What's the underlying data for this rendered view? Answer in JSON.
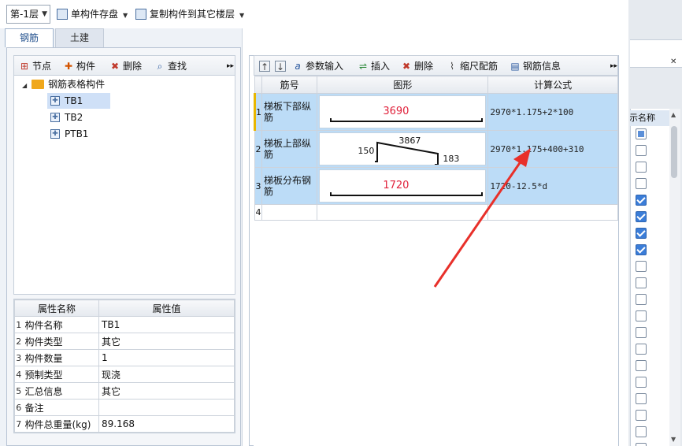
{
  "toolbar": {
    "floor": "第-1层",
    "single_save": "单构件存盘",
    "copy_to_floor": "复制构件到其它楼层"
  },
  "tabs": [
    "钢筋",
    "土建"
  ],
  "tree_toolbar": {
    "node": "节点",
    "component": "构件",
    "delete": "删除",
    "find": "查找"
  },
  "tree": {
    "root": "钢筋表格构件",
    "items": [
      "TB1",
      "TB2",
      "PTB1"
    ]
  },
  "props": {
    "header_name": "属性名称",
    "header_value": "属性值",
    "rows": [
      {
        "n": "1",
        "name": "构件名称",
        "value": "TB1"
      },
      {
        "n": "2",
        "name": "构件类型",
        "value": "其它"
      },
      {
        "n": "3",
        "name": "构件数量",
        "value": "1"
      },
      {
        "n": "4",
        "name": "预制类型",
        "value": "现浇"
      },
      {
        "n": "5",
        "name": "汇总信息",
        "value": "其它"
      },
      {
        "n": "6",
        "name": "备注",
        "value": ""
      },
      {
        "n": "7",
        "name": "构件总重量(kg)",
        "value": "89.168"
      }
    ]
  },
  "grid_toolbar": {
    "param_input": "参数输入",
    "insert": "插入",
    "delete": "删除",
    "scale": "缩尺配筋",
    "info": "钢筋信息"
  },
  "grid": {
    "headers": [
      "筋号",
      "图形",
      "计算公式"
    ],
    "rows": [
      {
        "n": "1",
        "name": "梯板下部纵筋",
        "shape_value": "3690",
        "formula": "2970*1.175+2*100"
      },
      {
        "n": "2",
        "name": "梯板上部纵筋",
        "shape_a": "150",
        "shape_b": "3867",
        "shape_c": "183",
        "formula": "2970*1.175+400+310"
      },
      {
        "n": "3",
        "name": "梯板分布钢筋",
        "shape_value": "1720",
        "formula": "1720-12.5*d"
      },
      {
        "n": "4",
        "name": "",
        "formula": ""
      }
    ]
  },
  "right_panel": {
    "header": "显示名称",
    "checkboxes": [
      "partial",
      "off",
      "off",
      "off",
      "on",
      "on",
      "on",
      "on",
      "off",
      "off",
      "off",
      "off",
      "off",
      "off",
      "off",
      "off",
      "off",
      "off",
      "off",
      "off"
    ]
  },
  "colors": {
    "highlight_row": "#bcdcf7",
    "shape_value": "#e0203a",
    "arrow": "#e8302a"
  }
}
